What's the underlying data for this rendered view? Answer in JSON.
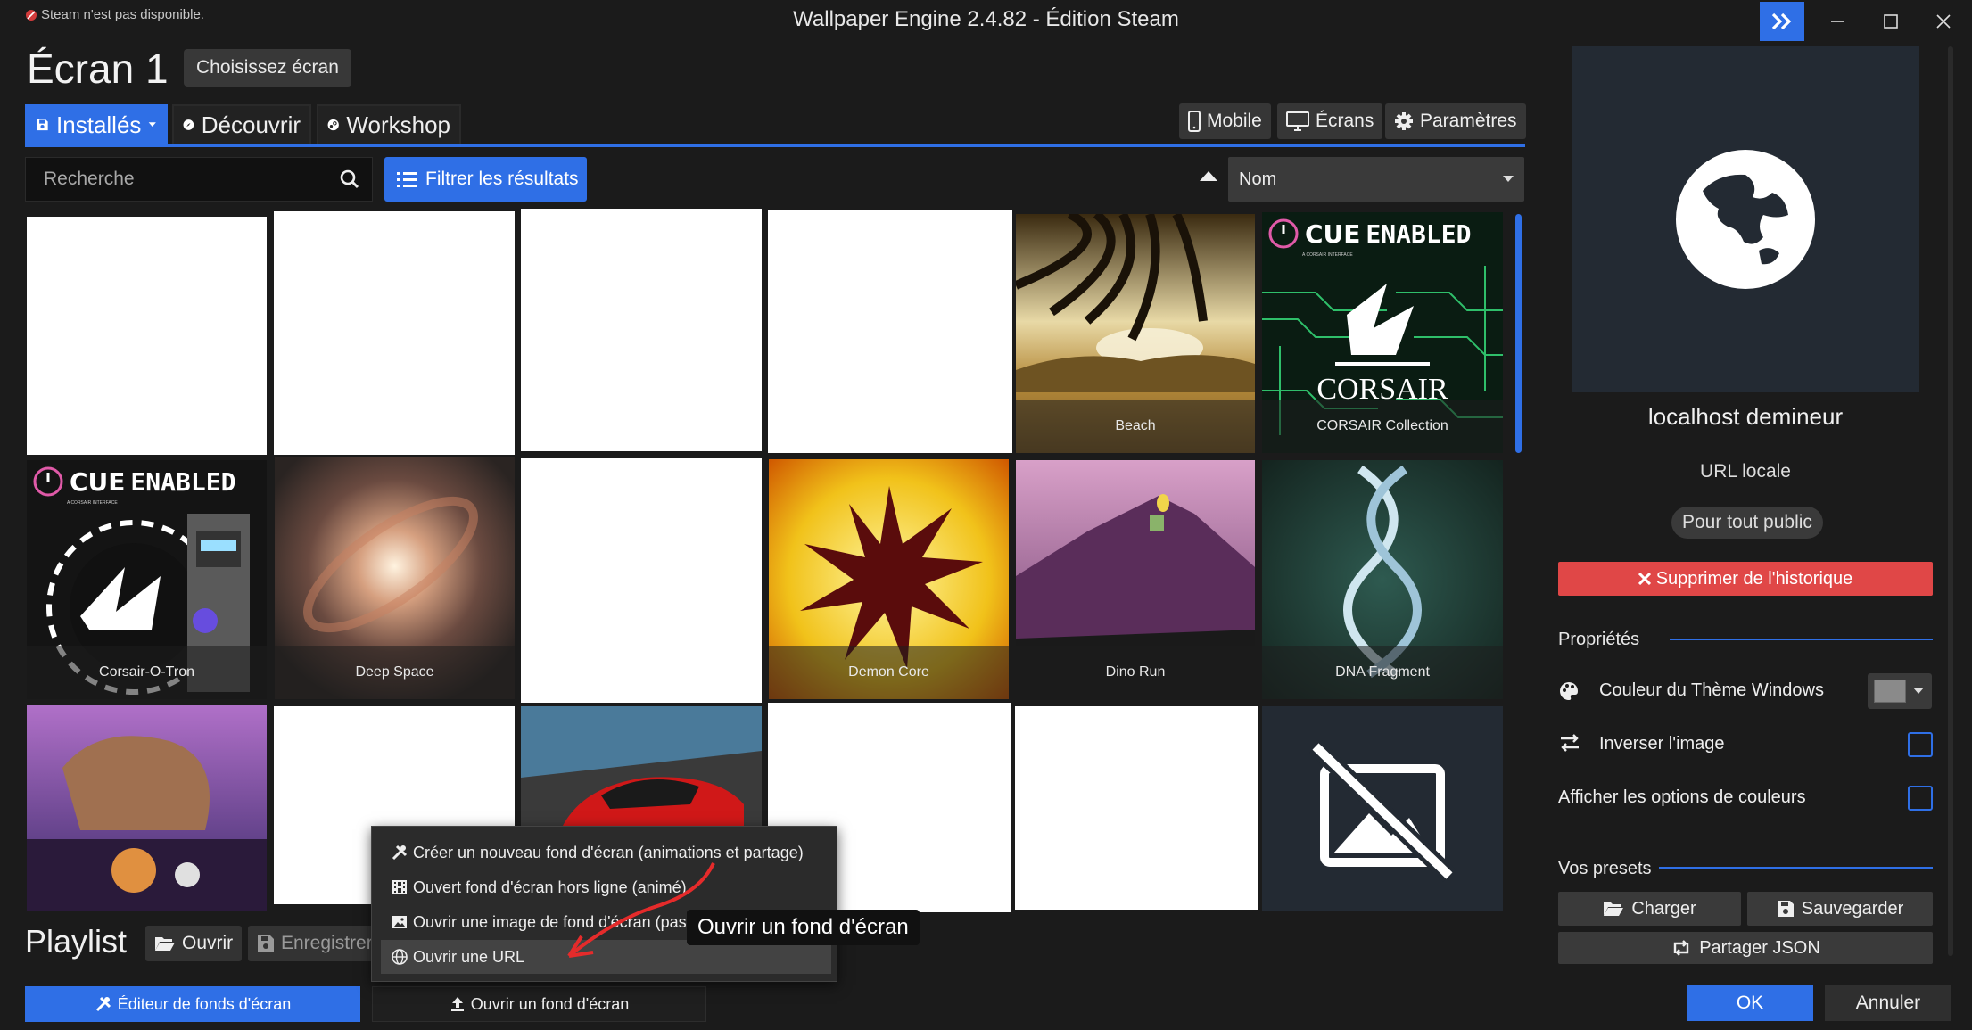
{
  "titlebar": {
    "steam_warning": "Steam n'est pas disponible.",
    "title": "Wallpaper Engine 2.4.82 - Édition Steam"
  },
  "header": {
    "screen_title": "Écran 1",
    "choose_screen": "Choisissez écran"
  },
  "tabs": [
    {
      "label": "Installés",
      "icon": "floppy-icon",
      "active": true
    },
    {
      "label": "Découvrir",
      "icon": "compass-icon",
      "active": false
    },
    {
      "label": "Workshop",
      "icon": "steam-icon",
      "active": false
    }
  ],
  "top_buttons": {
    "mobile": "Mobile",
    "screens": "Écrans",
    "settings": "Paramètres"
  },
  "search": {
    "placeholder": "Recherche",
    "filter_label": "Filtrer les résultats",
    "sort_value": "Nom"
  },
  "grid": {
    "captions": {
      "beach": "Beach",
      "corsair_collection": "CORSAIR Collection",
      "corsair_o_tron": "Corsair-O-Tron",
      "deep_space": "Deep Space",
      "demon_core": "Demon Core",
      "dino_run": "Dino Run",
      "dna_fragment": "DNA Fragment"
    },
    "cue_badge": {
      "cue": "CUE",
      "enabled": "ENABLED",
      "sub": "A CORSAIR INTERFACE"
    },
    "corsair_wordmark": "CORSAIR"
  },
  "playlist": {
    "title": "Playlist",
    "open": "Ouvrir",
    "save": "Enregistrer"
  },
  "bottom": {
    "editor": "Éditeur de fonds d'écran",
    "open_wallpaper": "Ouvrir un fond d'écran"
  },
  "context_menu": {
    "items": [
      {
        "label": "Créer un nouveau fond d'écran (animations et partage)",
        "icon": "tools-icon"
      },
      {
        "label": "Ouvert fond d'écran hors ligne (animé)",
        "icon": "film-icon"
      },
      {
        "label": "Ouvrir une image de fond d'écran (pas",
        "icon": "image-icon"
      },
      {
        "label": "Ouvrir une URL",
        "icon": "globe-icon"
      }
    ],
    "tooltip": "Ouvrir un fond d'écran"
  },
  "panel": {
    "title": "localhost demineur",
    "type": "URL locale",
    "rating": "Pour tout public",
    "remove_history": "Supprimer de l'historique",
    "properties_heading": "Propriétés",
    "theme_color_label": "Couleur du Thème Windows",
    "theme_color_value": "#8a8a8a",
    "invert_label": "Inverser l'image",
    "invert_checked": false,
    "color_options_label": "Afficher les options de couleurs",
    "color_options_checked": false,
    "presets_heading": "Vos presets",
    "load": "Charger",
    "save": "Sauvegarder",
    "share_json": "Partager JSON"
  },
  "dialog": {
    "ok": "OK",
    "cancel": "Annuler"
  },
  "colors": {
    "accent": "#2f6fe6",
    "danger": "#e04747",
    "annotation_arrow": "#e52b2b"
  }
}
